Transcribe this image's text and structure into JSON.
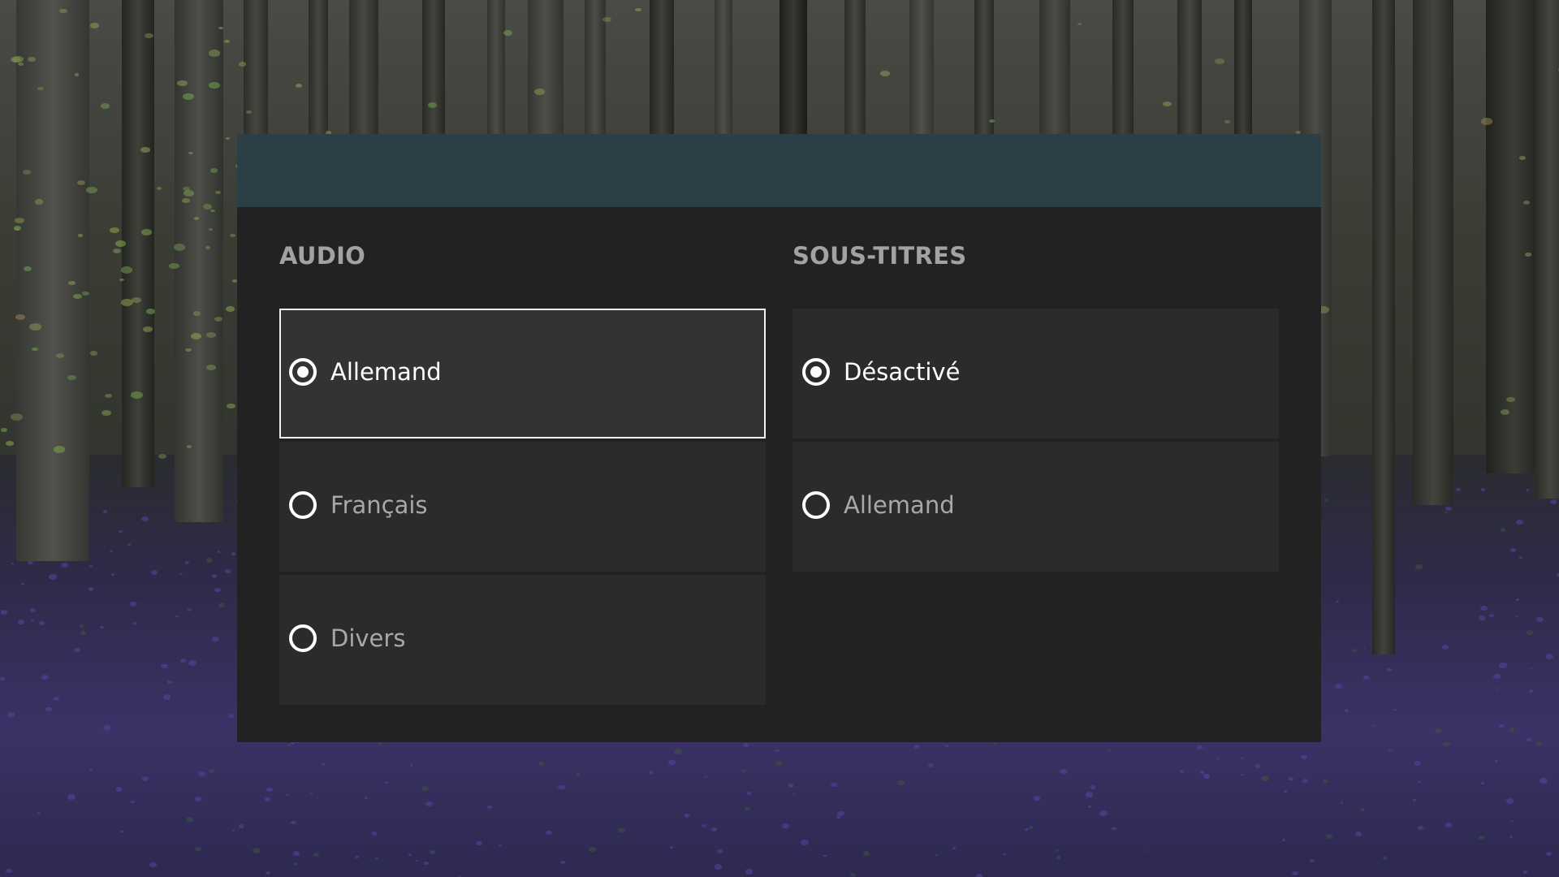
{
  "theme": {
    "header_color": "#2c3f47",
    "panel_color": "#222222",
    "option_color": "#2b2b2b",
    "focused_option_color": "#333333",
    "heading_color": "#a2a2a2"
  },
  "audio": {
    "heading": "AUDIO",
    "options": [
      {
        "label": "Allemand",
        "selected": true,
        "focused": true
      },
      {
        "label": "Français",
        "selected": false,
        "focused": false
      },
      {
        "label": "Divers",
        "selected": false,
        "focused": false
      }
    ]
  },
  "subtitles": {
    "heading": "SOUS-TITRES",
    "options": [
      {
        "label": "Désactivé",
        "selected": true,
        "focused": false
      },
      {
        "label": "Allemand",
        "selected": false,
        "focused": false
      }
    ]
  }
}
